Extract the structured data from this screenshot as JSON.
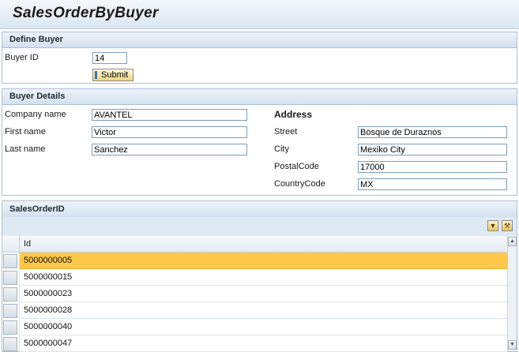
{
  "app": {
    "title": "SalesOrderByBuyer"
  },
  "define_buyer": {
    "header": "Define Buyer",
    "buyer_id_label": "Buyer ID",
    "buyer_id_value": "14",
    "submit_label": "Submit"
  },
  "buyer_details": {
    "header": "Buyer Details",
    "company_name_label": "Company name",
    "company_name_value": "AVANTEL",
    "first_name_label": "First name",
    "first_name_value": "Victor",
    "last_name_label": "Last name",
    "last_name_value": "Sanchez",
    "address": {
      "header": "Address",
      "street_label": "Street",
      "street_value": "Bosque de Duraznos",
      "city_label": "City",
      "city_value": "Mexiko City",
      "postal_code_label": "PostalCode",
      "postal_code_value": "17000",
      "country_code_label": "CountryCode",
      "country_code_value": "MX"
    }
  },
  "sales_orders": {
    "header": "SalesOrderID",
    "column_header": "Id",
    "rows": [
      "5000000005",
      "5000000015",
      "5000000023",
      "5000000028",
      "5000000040",
      "5000000047"
    ],
    "selected_row": 0,
    "toolbar": {
      "filter_icon": "filter-icon",
      "settings_icon": "wrench-icon"
    }
  }
}
